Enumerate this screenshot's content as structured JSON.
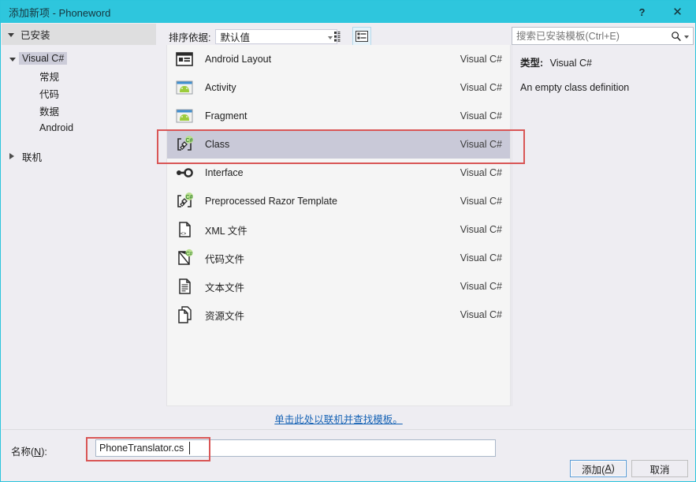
{
  "window": {
    "title": "添加新项 - Phoneword",
    "help_button": "?",
    "close_button": "✕",
    "accent_color": "#2ec6dd"
  },
  "toolbar": {
    "sortby_label": "排序依据:",
    "sortby_value": "默认值",
    "view_tiles_icon": "tiles-view-icon",
    "view_list_icon": "list-view-icon",
    "view_selected": "list"
  },
  "search": {
    "placeholder": "搜索已安装模板(Ctrl+E)",
    "value": "",
    "icon": "search-icon"
  },
  "sidebar": {
    "header": "已安装",
    "items": [
      {
        "label": "Visual C#",
        "level": 1,
        "expanded": true,
        "selected": true
      },
      {
        "label": "常规",
        "level": 3,
        "expanded": null,
        "selected": false
      },
      {
        "label": "代码",
        "level": 3,
        "expanded": null,
        "selected": false
      },
      {
        "label": "数据",
        "level": 3,
        "expanded": null,
        "selected": false
      },
      {
        "label": "Android",
        "level": 3,
        "expanded": null,
        "selected": false
      },
      {
        "label": "联机",
        "level": 1,
        "expanded": false,
        "selected": false
      }
    ]
  },
  "templates": {
    "items": [
      {
        "name": "Android Layout",
        "lang": "Visual C#",
        "icon": "android-layout-icon",
        "selected": false
      },
      {
        "name": "Activity",
        "lang": "Visual C#",
        "icon": "android-activity-icon",
        "selected": false
      },
      {
        "name": "Fragment",
        "lang": "Visual C#",
        "icon": "android-fragment-icon",
        "selected": false
      },
      {
        "name": "Class",
        "lang": "Visual C#",
        "icon": "csharp-class-icon",
        "selected": true
      },
      {
        "name": "Interface",
        "lang": "Visual C#",
        "icon": "interface-icon",
        "selected": false
      },
      {
        "name": "Preprocessed Razor Template",
        "lang": "Visual C#",
        "icon": "csharp-class-icon",
        "selected": false
      },
      {
        "name": "XML 文件",
        "lang": "Visual C#",
        "icon": "xml-file-icon",
        "selected": false
      },
      {
        "name": "代码文件",
        "lang": "Visual C#",
        "icon": "csharp-code-file-icon",
        "selected": false
      },
      {
        "name": "文本文件",
        "lang": "Visual C#",
        "icon": "text-file-icon",
        "selected": false
      },
      {
        "name": "资源文件",
        "lang": "Visual C#",
        "icon": "resource-file-icon",
        "selected": false
      }
    ]
  },
  "details": {
    "type_label": "类型:",
    "type_value": "Visual C#",
    "description": "An empty class definition"
  },
  "online_link": "单击此处以联机并查找模板。",
  "name_field": {
    "label_prefix": "名称(",
    "label_accel": "N",
    "label_suffix": "):",
    "value": "PhoneTranslator.cs",
    "placeholder": ""
  },
  "buttons": {
    "add_prefix": "添加(",
    "add_accel": "A",
    "add_suffix": ")",
    "cancel": "取消"
  },
  "annotations": {
    "color": "#d95656",
    "class_row_highlight": "Class",
    "name_field_highlight": "PhoneTranslator.cs"
  }
}
